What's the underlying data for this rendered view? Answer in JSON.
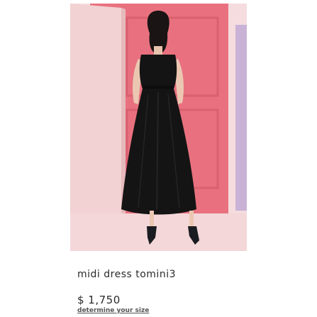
{
  "product": {
    "name": "midi dress tomini3",
    "price": "$ 1,750",
    "size_link": "determine your size"
  },
  "colors": {
    "backdrop_pink": "#e9717f",
    "floor": "#f6dfe0",
    "dress": "#141414",
    "text": "#2a2a2a"
  }
}
